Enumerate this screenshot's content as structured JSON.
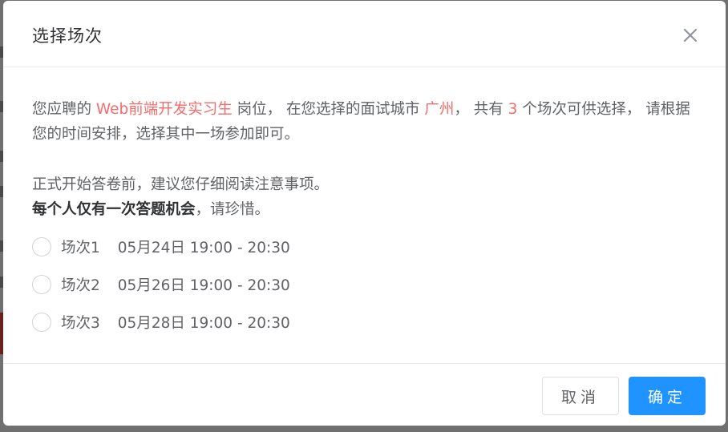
{
  "dialog": {
    "title": "选择场次",
    "intro": {
      "p1": "您应聘的 ",
      "position": "Web前端开发实习生",
      "p2": " 岗位， 在您选择的面试城市 ",
      "city": "广州",
      "p3": "， 共有 ",
      "count": "3",
      "p4": " 个场次可供选择， 请根据您的时间安排，选择其中一场参加即可。"
    },
    "notice": "正式开始答卷前，建议您仔细阅读注意事项。",
    "warning_bold": "每个人仅有一次答题机会",
    "warning_rest": "，请珍惜。",
    "sessions": [
      {
        "name": "场次1",
        "time": "05月24日 19:00 - 20:30"
      },
      {
        "name": "场次2",
        "time": "05月26日 19:00 - 20:30"
      },
      {
        "name": "场次3",
        "time": "05月28日 19:00 - 20:30"
      }
    ],
    "cancel_label": "取消",
    "confirm_label": "确定"
  },
  "colors": {
    "highlight": "#f56c6c",
    "primary": "#1f93ff"
  },
  "icons": {
    "close": "close-icon"
  }
}
